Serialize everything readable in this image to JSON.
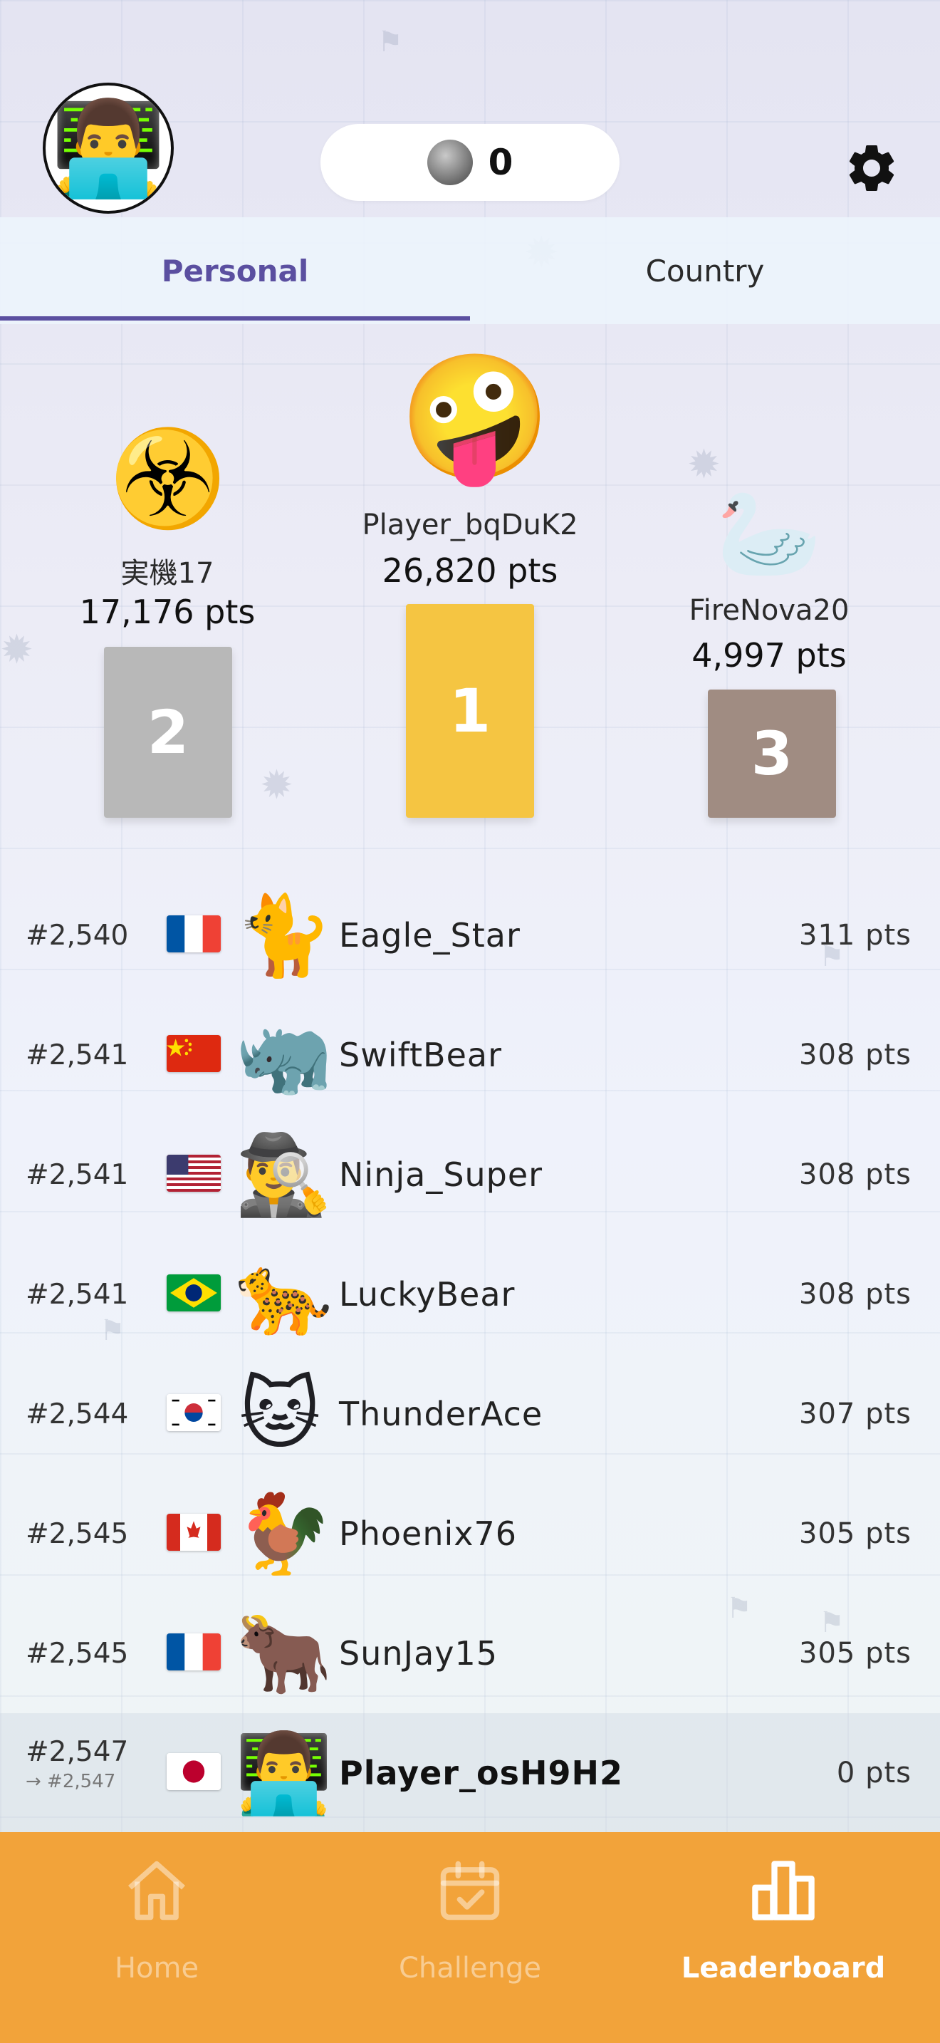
{
  "header": {
    "avatar_emoji": "👨‍💻",
    "coins": "0",
    "coin_icon": "silver-coin-icon",
    "settings_icon": "gear-icon"
  },
  "tabs": [
    {
      "label": "Personal",
      "active": true
    },
    {
      "label": "Country",
      "active": false
    }
  ],
  "podium": {
    "first": {
      "emoji": "🤪",
      "name": "Player_bqDuK2",
      "points": "26,820 pts",
      "place": "1",
      "color": "#f5c542"
    },
    "second": {
      "emoji": "☣️",
      "name": "実機17",
      "points": "17,176 pts",
      "place": "2",
      "color": "#b8b8b8"
    },
    "third": {
      "emoji": "🦢",
      "name": "FireNova20",
      "points": "4,997 pts",
      "place": "3",
      "color": "#a08c82"
    }
  },
  "leaderboard": [
    {
      "rank": "#2,540",
      "flag": "france",
      "emoji": "🐈",
      "name": "Eagle_Star",
      "points": "311 pts"
    },
    {
      "rank": "#2,541",
      "flag": "china",
      "emoji": "🦏",
      "name": "SwiftBear",
      "points": "308 pts"
    },
    {
      "rank": "#2,541",
      "flag": "usa",
      "emoji": "🕵️‍♂️",
      "name": "Ninja_Super",
      "points": "308 pts"
    },
    {
      "rank": "#2,541",
      "flag": "brazil",
      "emoji": "🐆",
      "name": "LuckyBear",
      "points": "308 pts"
    },
    {
      "rank": "#2,544",
      "flag": "south-korea",
      "emoji": "🐱",
      "name": "ThunderAce",
      "points": "307 pts"
    },
    {
      "rank": "#2,545",
      "flag": "canada",
      "emoji": "🐓",
      "name": "Phoenix76",
      "points": "305 pts"
    },
    {
      "rank": "#2,545",
      "flag": "france",
      "emoji": "🐂",
      "name": "SunJay15",
      "points": "305 pts"
    }
  ],
  "current_user": {
    "rank": "#2,547",
    "previous_rank": "→ #2,547",
    "flag": "japan",
    "emoji": "👨‍💻",
    "name": "Player_osH9H2",
    "points": "0 pts"
  },
  "bottom_nav": [
    {
      "label": "Home",
      "icon": "home-icon",
      "active": false
    },
    {
      "label": "Challenge",
      "icon": "calendar-check-icon",
      "active": false
    },
    {
      "label": "Leaderboard",
      "icon": "bar-chart-icon",
      "active": true
    }
  ],
  "colors": {
    "accent": "#5b4fa0",
    "nav_background": "#f2a33a",
    "gold": "#f5c542",
    "silver": "#b8b8b8",
    "bronze": "#a08c82"
  }
}
